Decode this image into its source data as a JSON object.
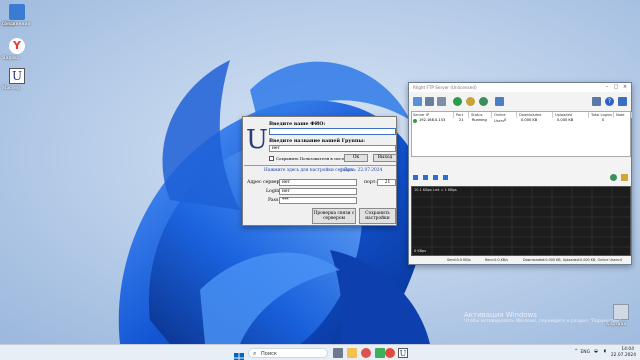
{
  "desktop": {
    "icons": [
      {
        "label_line1": "Цепи",
        "label_line2": "соединения"
      },
      {
        "label_line1": "Яндекс",
        "label_line2": ""
      },
      {
        "label_line1": "Мастер",
        "label_line2": ""
      },
      {
        "label_line1": "Корзина",
        "label_line2": ""
      }
    ]
  },
  "app_dialog": {
    "logo": "U",
    "fio_label": "Введите ваше ФИО:",
    "fio_value": "",
    "group_label": "Введите название вашей Группы:",
    "group_value": "нет",
    "save_checkbox_label": "Сохранить Пользователя в системе",
    "ok_button": "Ок",
    "exit_button": "Выход",
    "settings_link": "Нажмите здесь для настройки сервера",
    "date_info": "| Дата: 22.07.2024",
    "server_address_label": "Адрес сервера:",
    "server_address_value": "нет",
    "port_label": "порт:",
    "port_value": "21",
    "login_label": "Login:",
    "login_value": "нет",
    "password_label": "Pass:",
    "password_value": "***",
    "check_connection_button_line1": "Проверка связи с",
    "check_connection_button_line2": "сервером",
    "save_settings_button_line1": "Сохранить",
    "save_settings_button_line2": "настройки"
  },
  "ftp_window": {
    "title": "Rlight FTP Server (Unlicensed)",
    "columns": [
      "Server IP",
      "Port",
      "Status",
      "Online Users",
      "Downloaded",
      "Uploaded",
      "Total Logins",
      "Note"
    ],
    "rows": [
      {
        "ip": "192.168.0.153",
        "port": "21",
        "status": "Running",
        "online": "0",
        "downloaded": "0.000 KB",
        "uploaded": "0.000 KB",
        "logins": "0",
        "note": ""
      }
    ],
    "log_top": "10.1 KBps   Lmt = 1 KBps",
    "log_bottom": "0 KBps",
    "status_bar": {
      "send": "Send:0.0 KB/s",
      "recv": "Recv:0.0 KB/s",
      "totals": "Downloaded:0.000 KB, Uploaded:0.000 KB, Online Users:0"
    }
  },
  "watermark": {
    "line1": "Активация Windows",
    "line2": "Чтобы активировать Windows, перейдите в раздел \"Параметры\"."
  },
  "taskbar": {
    "search_placeholder": "Поиск",
    "language": "ENG",
    "time": "14:04",
    "date": "22.07.2024"
  },
  "colors": {
    "wallpaper_bg": "#a9c4e6",
    "bloom_dark": "#0b3fb5",
    "bloom_light": "#3f86ef",
    "ftp_log_bg": "#1c1c1c",
    "accent": "#0067c0"
  }
}
